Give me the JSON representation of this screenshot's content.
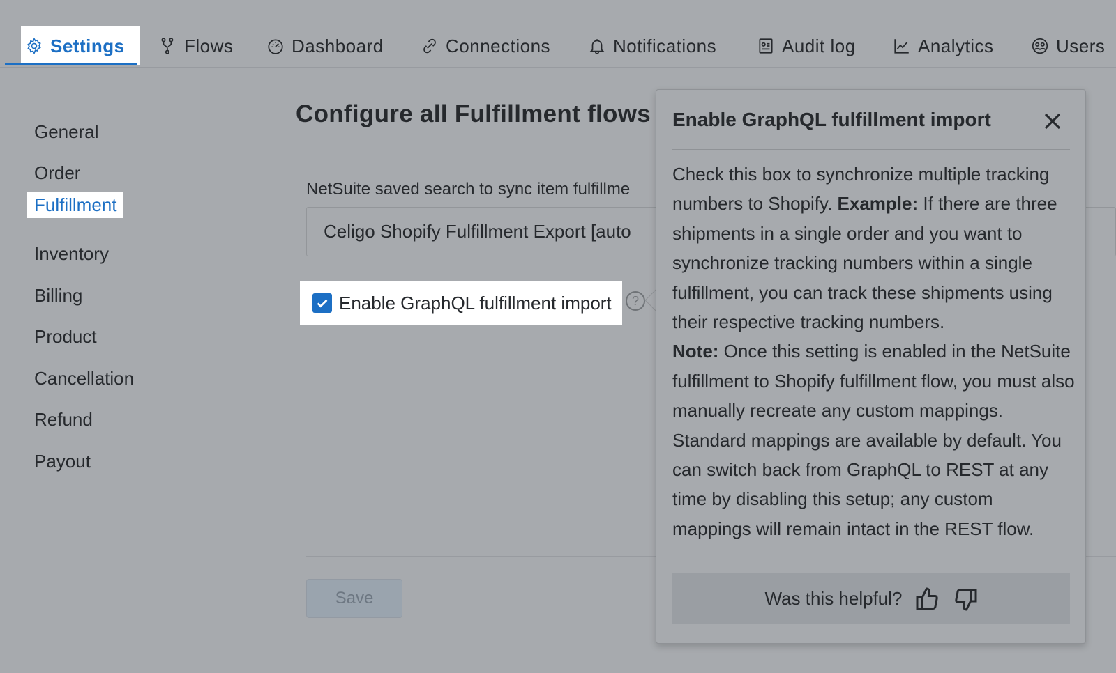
{
  "tabs": [
    {
      "label": "Settings",
      "icon": "gear-icon",
      "active": true
    },
    {
      "label": "Flows",
      "icon": "flow-icon"
    },
    {
      "label": "Dashboard",
      "icon": "speedometer-icon"
    },
    {
      "label": "Connections",
      "icon": "link-icon"
    },
    {
      "label": "Notifications",
      "icon": "bell-icon"
    },
    {
      "label": "Audit log",
      "icon": "audit-log-icon"
    },
    {
      "label": "Analytics",
      "icon": "chart-line-icon"
    },
    {
      "label": "Users",
      "icon": "users-icon"
    }
  ],
  "sidebar": {
    "items": [
      {
        "label": "General"
      },
      {
        "label": "Order"
      },
      {
        "label": "Fulfillment",
        "active": true
      },
      {
        "label": "Inventory"
      },
      {
        "label": "Billing"
      },
      {
        "label": "Product"
      },
      {
        "label": "Cancellation"
      },
      {
        "label": "Refund"
      },
      {
        "label": "Payout"
      }
    ]
  },
  "main": {
    "title": "Configure all Fulfillment flows",
    "saved_search_label": "NetSuite saved search to sync item fulfillme",
    "saved_search_value": "Celigo Shopify Fulfillment Export [auto",
    "checkbox_label": "Enable GraphQL fulfillment import",
    "checkbox_checked": true,
    "help_icon_text": "?",
    "save_label": "Save"
  },
  "popover": {
    "title": "Enable GraphQL fulfillment import",
    "para1_pre": "Check this box to synchronize multiple tracking numbers to Shopify. ",
    "para1_bold": "Example:",
    "para1_post": " If there are three shipments in a single order and you want to synchronize tracking numbers within a single fulfillment, you can track these shipments using their respective tracking numbers.",
    "para2_bold": "Note:",
    "para2_post": " Once this setting is enabled in the NetSuite fulfillment to Shopify fulfillment flow, you must also manually recreate any custom mappings. Standard mappings are available by default. You can switch back from GraphQL to REST at any time by disabling this setup; any custom mappings will remain intact in the REST flow.",
    "footer_text": "Was this helpful?"
  },
  "colors": {
    "accent": "#1c6fc4",
    "overlay_background": "#a7aaae"
  }
}
